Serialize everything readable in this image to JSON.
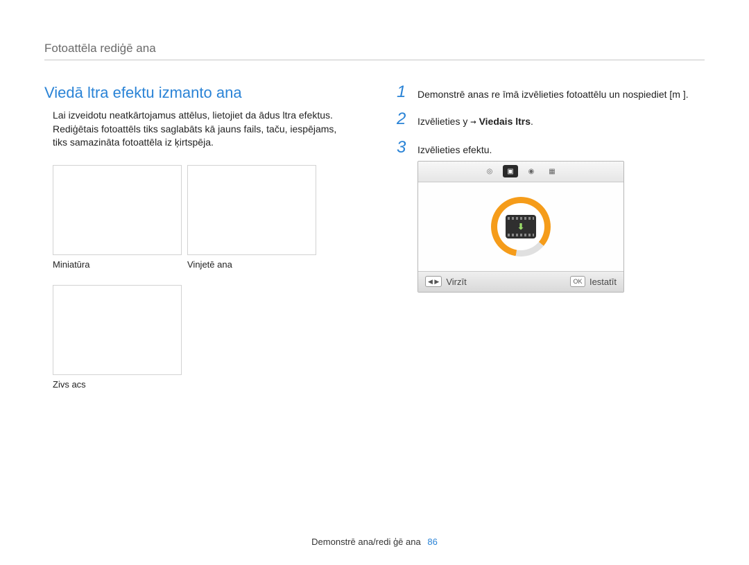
{
  "header": {
    "title": "Fotoattēla rediģē ana"
  },
  "left": {
    "section_title": "Viedā   ltra efektu izmanto ana",
    "body": "Lai izveidotu neatkārtojamus attēlus, lietojiet da ādus  ltra efektus. Rediģētais fotoattēls tiks saglabāts kā jauns fails, taču, iespējams, tiks samazināta fotoattēla iz ķirtspēja.",
    "thumbs": [
      {
        "label": "Miniatūra"
      },
      {
        "label": "Vinjetē ana"
      },
      {
        "label": "Zivs acs"
      }
    ]
  },
  "right": {
    "steps": [
      {
        "num": "1",
        "text_a": "Demonstrē anas re  īmā izvēlieties fotoattēlu un nospiediet [m       ]."
      },
      {
        "num": "2",
        "text_a": "Izvēlieties y      ",
        "arrow": "→",
        "bold": " Viedais  ltrs",
        "text_b": "."
      },
      {
        "num": "3",
        "text_a": "Izvēlieties efektu."
      }
    ],
    "screen": {
      "footer_left": "Virzīt",
      "footer_button": "OK",
      "footer_right": "Iestatīt",
      "nav_chip": "◀  ▶"
    }
  },
  "footer": {
    "text": "Demonstrē ana/redi ģē ana",
    "page": "86"
  }
}
